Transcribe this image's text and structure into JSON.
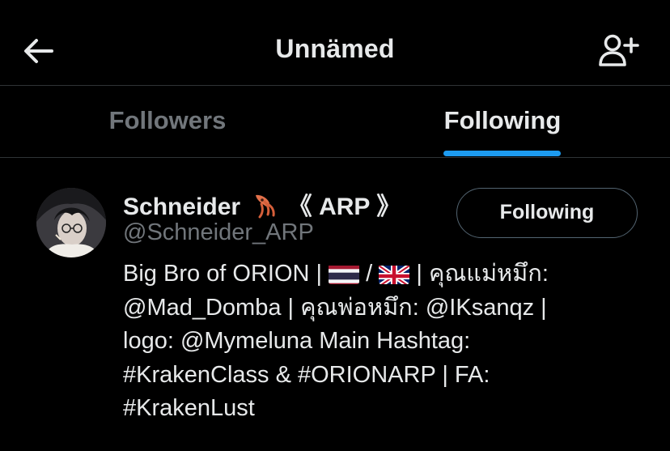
{
  "header": {
    "title": "Unnämed",
    "back_icon": "arrow-left-icon",
    "add_user_icon": "person-add-icon"
  },
  "tabs": [
    {
      "label": "Followers",
      "active": false
    },
    {
      "label": "Following",
      "active": true
    }
  ],
  "colors": {
    "accent": "#1d9bf0",
    "background": "#000000",
    "text_primary": "#e7e9ea",
    "text_secondary": "#71767b",
    "divider": "#2f3336"
  },
  "user": {
    "name_prefix": "Schneider",
    "name_emoji_icon": "squid-icon",
    "name_suffix": "《 ARP 》",
    "handle": "@Schneider_ARP",
    "follow_button_label": "Following",
    "bio": {
      "line1_a": "Big Bro of ORION | ",
      "line1_flag1": "thailand-flag-icon",
      "line1_sep": " / ",
      "line1_flag2": "uk-flag-icon",
      "line1_b": " | คุณแม่หมึก:",
      "line2": "@Mad_Domba | คุณพ่อหมึก: @IKsanqz |",
      "line3": "logo: @Mymeluna Main Hashtag:",
      "line4": "#KrakenClass & #ORIONARP | FA:",
      "line5": "#KrakenLust"
    }
  }
}
